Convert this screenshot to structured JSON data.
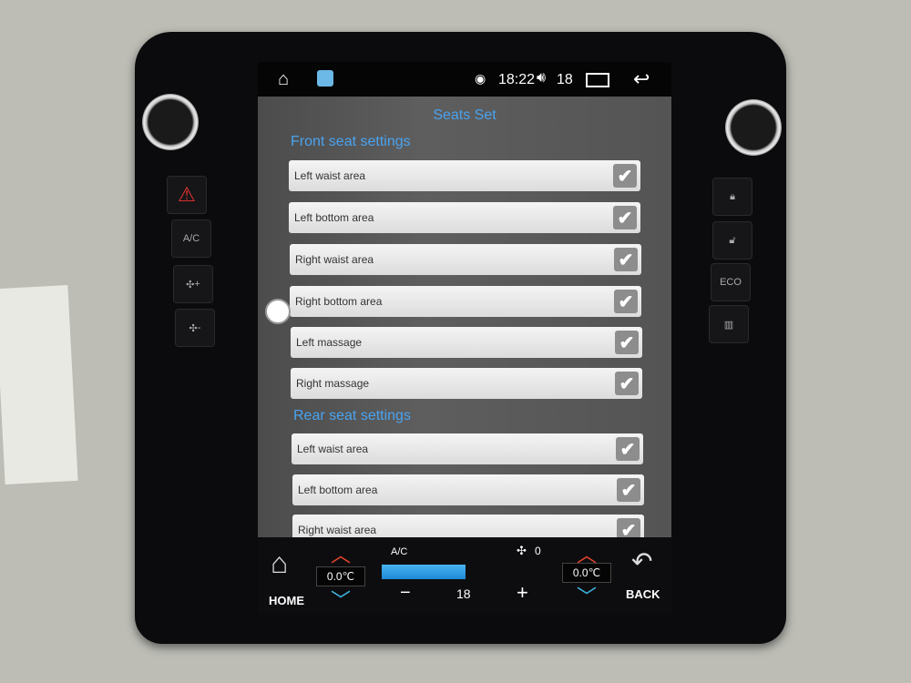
{
  "status_bar": {
    "time": "18:22",
    "volume": "18",
    "icons": [
      "home-icon",
      "app-icon",
      "hotspot-icon",
      "volume-icon",
      "recents-icon",
      "back-icon"
    ]
  },
  "page": {
    "title": "Seats Set"
  },
  "front": {
    "header": "Front seat settings",
    "items": [
      {
        "label": "Left waist area",
        "checked": true
      },
      {
        "label": "Left bottom area",
        "checked": true
      },
      {
        "label": "Right waist area",
        "checked": true
      },
      {
        "label": "Right bottom area",
        "checked": true
      },
      {
        "label": "Left massage",
        "checked": true
      },
      {
        "label": "Right massage",
        "checked": true
      }
    ]
  },
  "rear": {
    "header": "Rear seat settings",
    "items": [
      {
        "label": "Left waist area",
        "checked": true
      },
      {
        "label": "Left bottom area",
        "checked": true
      },
      {
        "label": "Right waist area",
        "checked": true
      }
    ]
  },
  "climate": {
    "home_label": "HOME",
    "back_label": "BACK",
    "left_temp": "0.0℃",
    "right_temp": "0.0℃",
    "ac_label": "A/C",
    "fan_speed": "0",
    "set_temp": "18",
    "minus": "−",
    "plus": "+",
    "check": "✔"
  },
  "hardware": {
    "ac": "A/C",
    "fan_plus": "+",
    "fan_minus": "-",
    "eco": "ECO"
  },
  "colors": {
    "accent": "#4aa3f0",
    "up_arrow": "#e8452c",
    "down_arrow": "#3fb8e8"
  }
}
